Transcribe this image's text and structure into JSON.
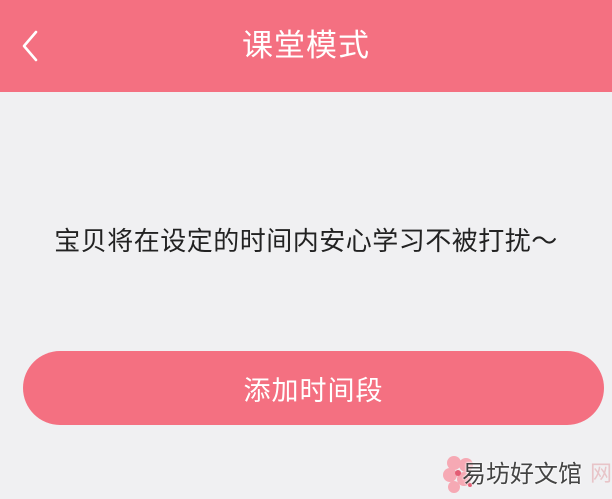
{
  "header": {
    "title": "课堂模式",
    "back_icon": "chevron-left-icon"
  },
  "main": {
    "message": "宝贝将在设定的时间内安心学习不被打扰～",
    "add_button_label": "添加时间段"
  },
  "watermark": {
    "text": "易坊好文馆",
    "faded_text": "网"
  },
  "colors": {
    "accent": "#f47081",
    "background": "#f0f0f2",
    "text": "#222222"
  }
}
